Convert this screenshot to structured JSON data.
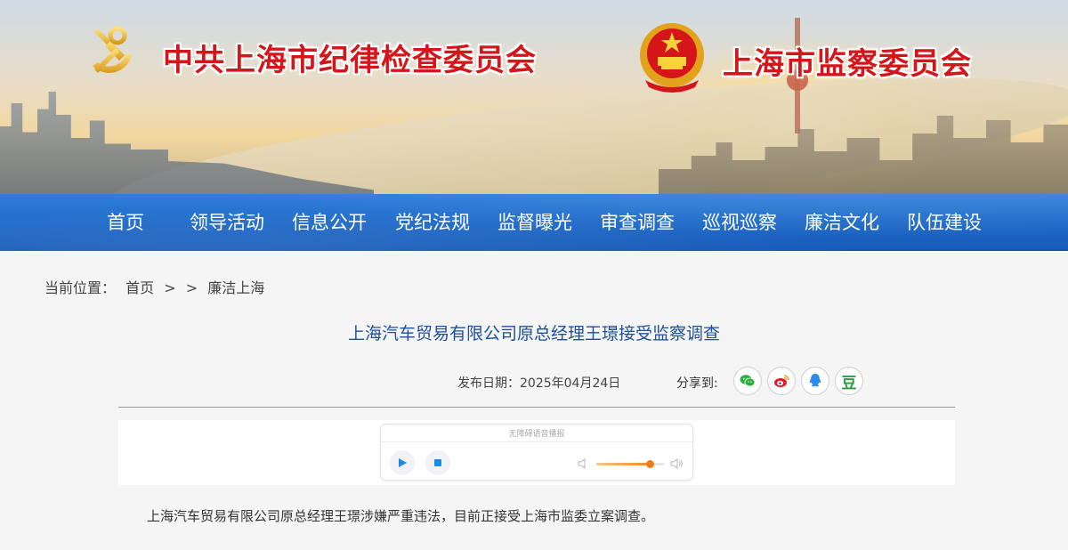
{
  "header": {
    "title_left": "中共上海市纪律检查委员会",
    "title_right": "上海市监察委员会",
    "emblem_left_icon": "party-emblem-icon",
    "emblem_right_icon": "national-emblem-icon"
  },
  "nav": {
    "items": [
      {
        "label": "首页"
      },
      {
        "label": "领导活动"
      },
      {
        "label": "信息公开"
      },
      {
        "label": "党纪法规"
      },
      {
        "label": "监督曝光"
      },
      {
        "label": "审查调查"
      },
      {
        "label": "巡视巡察"
      },
      {
        "label": "廉洁文化"
      },
      {
        "label": "队伍建设"
      }
    ],
    "bg_color": "#1d63c4"
  },
  "breadcrumb": {
    "prefix": "当前位置：",
    "home": "首页",
    "sep1": ">",
    "sep2": ">",
    "current": "廉洁上海"
  },
  "article": {
    "title": "上海汽车贸易有限公司原总经理王璟接受监察调查",
    "publish_label": "发布日期：2025年04月24日",
    "share_label": "分享到:",
    "share": {
      "wechat_icon": "wechat-icon",
      "weibo_icon": "weibo-icon",
      "qq_icon": "qq-icon",
      "douban_label": "豆"
    },
    "body": "上海汽车贸易有限公司原总经理王璟涉嫌严重违法，目前正接受上海市监委立案调查。"
  },
  "player": {
    "caption": "无障碍语音播报",
    "volume": 0.8,
    "accent_color": "#f07c16"
  }
}
